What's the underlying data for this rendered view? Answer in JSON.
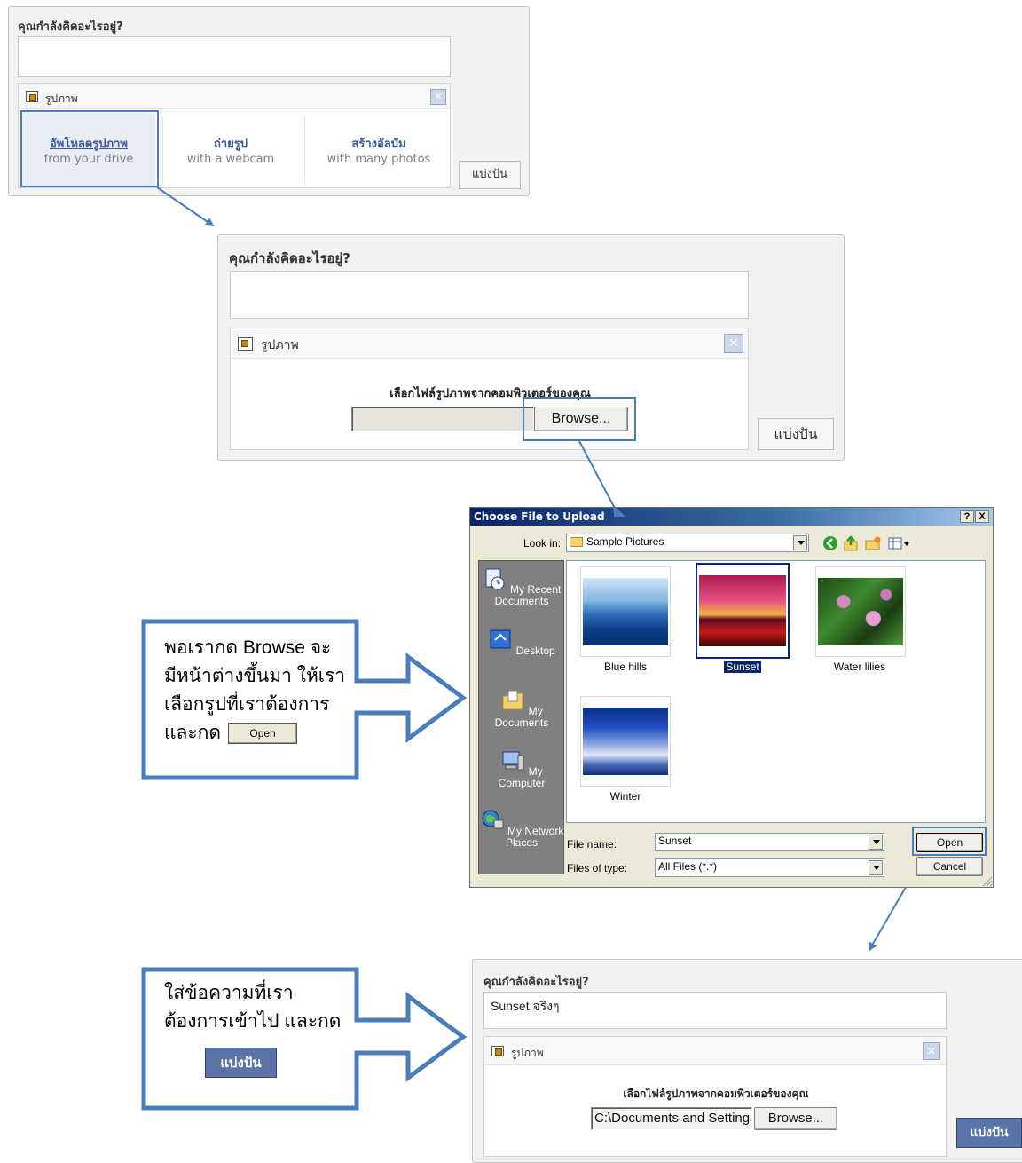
{
  "panel1": {
    "title": "คุณกำลังคิดอะไรอยู่?",
    "photo_label": "รูปภาพ",
    "close_glyph": "✕",
    "options": [
      {
        "title": "อัพโหลดรูปภาพ",
        "subtitle": "from your drive"
      },
      {
        "title": "ถ่ายรูป",
        "subtitle": "with a webcam"
      },
      {
        "title": "สร้างอัลบัม",
        "subtitle": "with many photos"
      }
    ],
    "share_label": "แบ่งปัน"
  },
  "panel2": {
    "title": "คุณกำลังคิดอะไรอยู่?",
    "photo_label": "รูปภาพ",
    "close_glyph": "✕",
    "choose_label": "เลือกไฟล์รูปภาพจากคอมพิวเตอร์ของคุณ",
    "file_value": "",
    "browse_label": "Browse...",
    "share_label": "แบ่งปัน"
  },
  "dialog": {
    "title": "Choose File to Upload",
    "help_glyph": "?",
    "close_glyph": "X",
    "look_in_label": "Look in:",
    "look_in_value": "Sample Pictures",
    "places": [
      {
        "label": "My Recent Documents",
        "icon": "recent-documents-icon"
      },
      {
        "label": "Desktop",
        "icon": "desktop-icon"
      },
      {
        "label": "My Documents",
        "icon": "my-documents-icon"
      },
      {
        "label": "My Computer",
        "icon": "my-computer-icon"
      },
      {
        "label": "My Network Places",
        "icon": "network-places-icon"
      }
    ],
    "files": [
      {
        "name": "Blue hills",
        "selected": false
      },
      {
        "name": "Sunset",
        "selected": true
      },
      {
        "name": "Water lilies",
        "selected": false
      },
      {
        "name": "Winter",
        "selected": false
      }
    ],
    "file_name_label": "File name:",
    "file_name_value": "Sunset",
    "file_type_label": "Files of type:",
    "file_type_value": "All Files (*.*)",
    "open_label": "Open",
    "cancel_label": "Cancel"
  },
  "callout1": {
    "text": "พอเรากด Browse จะมีหน้าต่างขึ้นมา ให้เราเลือกรูปที่เราต้องการและกด",
    "open_label": "Open"
  },
  "callout2": {
    "text": "ใส่ข้อความที่เราต้องการเข้าไป และกด",
    "share_label": "แบ่งปัน"
  },
  "panel3": {
    "title": "คุณกำลังคิดอะไรอยู่?",
    "status_text": "Sunset จริงๆ",
    "photo_label": "รูปภาพ",
    "close_glyph": "✕",
    "choose_label": "เลือกไฟล์รูปภาพจากคอมพิวเตอร์ของคุณ",
    "file_value": "C:\\Documents and Settings",
    "browse_label": "Browse...",
    "share_label": "แบ่งปัน"
  },
  "colors": {
    "accent_outline": "#4a7ebb",
    "facebook_blue": "#3b5998"
  }
}
